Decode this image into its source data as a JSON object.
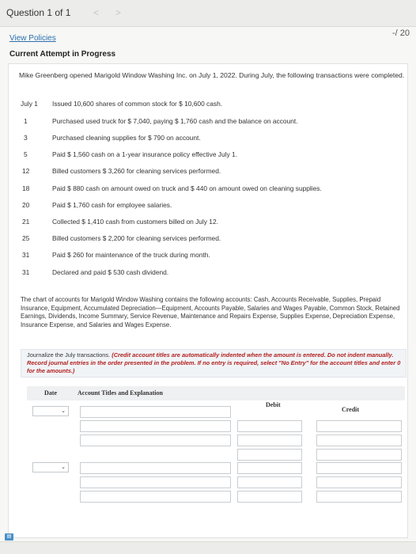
{
  "header": {
    "question_label": "Question 1 of 1",
    "prev_arrow": "<",
    "next_arrow": ">",
    "score": "-/ 20"
  },
  "links": {
    "view_policies": "View Policies"
  },
  "attempt_status": "Current Attempt in Progress",
  "problem": {
    "intro": "Mike Greenberg opened Marigold Window Washing Inc. on July 1, 2022. During July, the following transactions were completed.",
    "transactions": [
      {
        "date": "July 1",
        "desc": "Issued 10,600 shares of common stock for $ 10,600 cash."
      },
      {
        "date": "1",
        "desc": "Purchased used truck for $ 7,040, paying $ 1,760 cash and the balance on account."
      },
      {
        "date": "3",
        "desc": "Purchased cleaning supplies for $ 790 on account."
      },
      {
        "date": "5",
        "desc": "Paid $ 1,560 cash on a 1-year insurance policy effective July 1."
      },
      {
        "date": "12",
        "desc": "Billed customers $ 3,260 for cleaning services performed."
      },
      {
        "date": "18",
        "desc": "Paid $ 880 cash on amount owed on truck and $ 440 on amount owed on cleaning supplies."
      },
      {
        "date": "20",
        "desc": "Paid $ 1,760 cash for employee salaries."
      },
      {
        "date": "21",
        "desc": "Collected $ 1,410 cash from customers billed on July 12."
      },
      {
        "date": "25",
        "desc": "Billed customers $ 2,200 for cleaning services performed."
      },
      {
        "date": "31",
        "desc": "Paid $ 260 for maintenance of the truck during month."
      },
      {
        "date": "31",
        "desc": "Declared and paid $ 530 cash dividend."
      }
    ],
    "chart_of_accounts": "The chart of accounts for Marigold Window Washing contains the following accounts: Cash, Accounts Receivable, Supplies, Prepaid Insurance, Equipment, Accumulated Depreciation—Equipment, Accounts Payable, Salaries and Wages Payable, Common Stock, Retained Earnings, Dividends, Income Summary, Service Revenue, Maintenance and Repairs Expense, Supplies Expense, Depreciation Expense, Insurance Expense, and Salaries and Wages Expense."
  },
  "instructions": {
    "lead": "Journalize the July transactions.",
    "emphasis": "(Credit account titles are automatically indented when the amount is entered. Do not indent manually. Record journal entries in the order presented in the problem. If no entry is required, select \"No Entry\" for the account titles and enter 0 for the amounts.)"
  },
  "journal": {
    "headers": {
      "date": "Date",
      "account": "Account Titles and Explanation",
      "debit": "Debit",
      "credit": "Credit"
    }
  },
  "corner_icon_label": "▤"
}
